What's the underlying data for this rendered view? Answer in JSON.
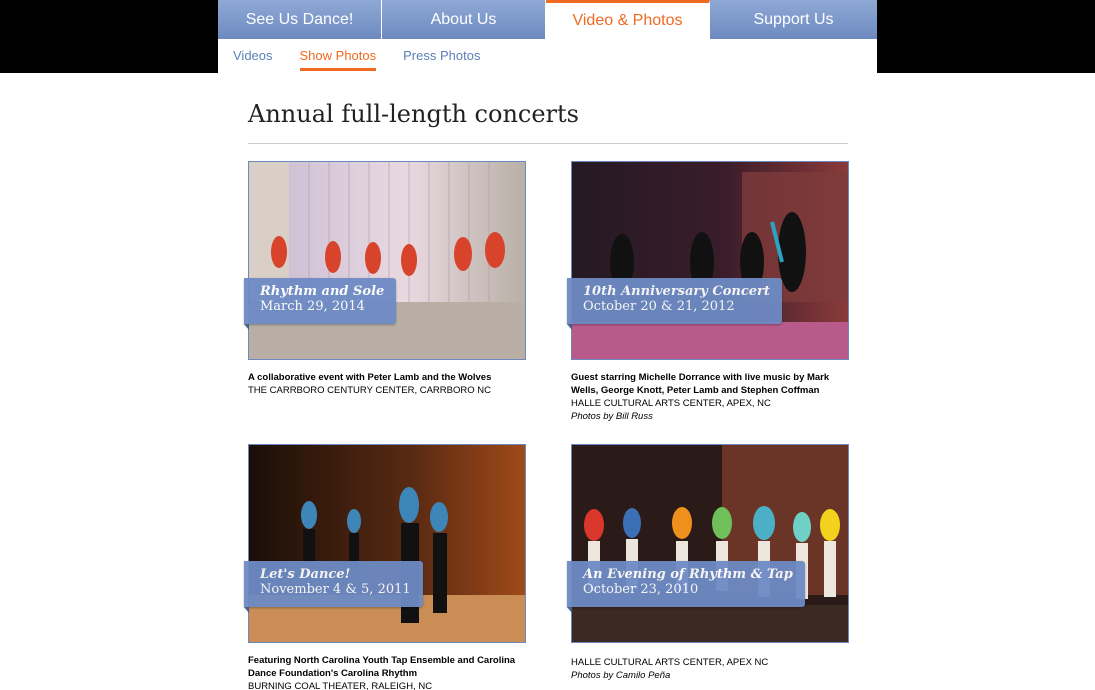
{
  "nav": {
    "tabs": [
      {
        "label": "See Us Dance!"
      },
      {
        "label": "About Us"
      },
      {
        "label": "Video & Photos"
      },
      {
        "label": "Support Us"
      }
    ],
    "subtabs": [
      {
        "label": "Videos"
      },
      {
        "label": "Show Photos"
      },
      {
        "label": "Press Photos"
      }
    ]
  },
  "page": {
    "title": "Annual full-length concerts"
  },
  "cards": [
    {
      "title": "Rhythm and Sole",
      "date": "March 29, 2014",
      "description": "A collaborative event with Peter Lamb and the Wolves",
      "venue": "THE CARRBORO CENTURY CENTER, CARRBORO NC",
      "credit": ""
    },
    {
      "title": "10th Anniversary Concert",
      "date": "October 20 & 21, 2012",
      "description": "Guest starring Michelle Dorrance with live music by Mark Wells, George Knott, Peter Lamb and Stephen Coffman",
      "venue": "HALLE CULTURAL ARTS CENTER, APEX, NC",
      "credit": "Photos by Bill Russ"
    },
    {
      "title": "Let's Dance!",
      "date": "November 4 & 5, 2011",
      "description": "Featuring North Carolina Youth Tap Ensemble and Carolina Dance Foundation's Carolina Rhythm",
      "venue": "BURNING COAL THEATER, RALEIGH, NC",
      "credit": ""
    },
    {
      "title": "An Evening of Rhythm & Tap",
      "date": "October 23, 2010",
      "description": "",
      "venue": "HALLE CULTURAL ARTS CENTER, APEX NC",
      "credit": "Photos by Camilo Peña"
    }
  ],
  "colors": {
    "accent_orange": "#f06a22",
    "nav_blue": "#6d8ac0",
    "link_blue": "#5a7fb8"
  }
}
